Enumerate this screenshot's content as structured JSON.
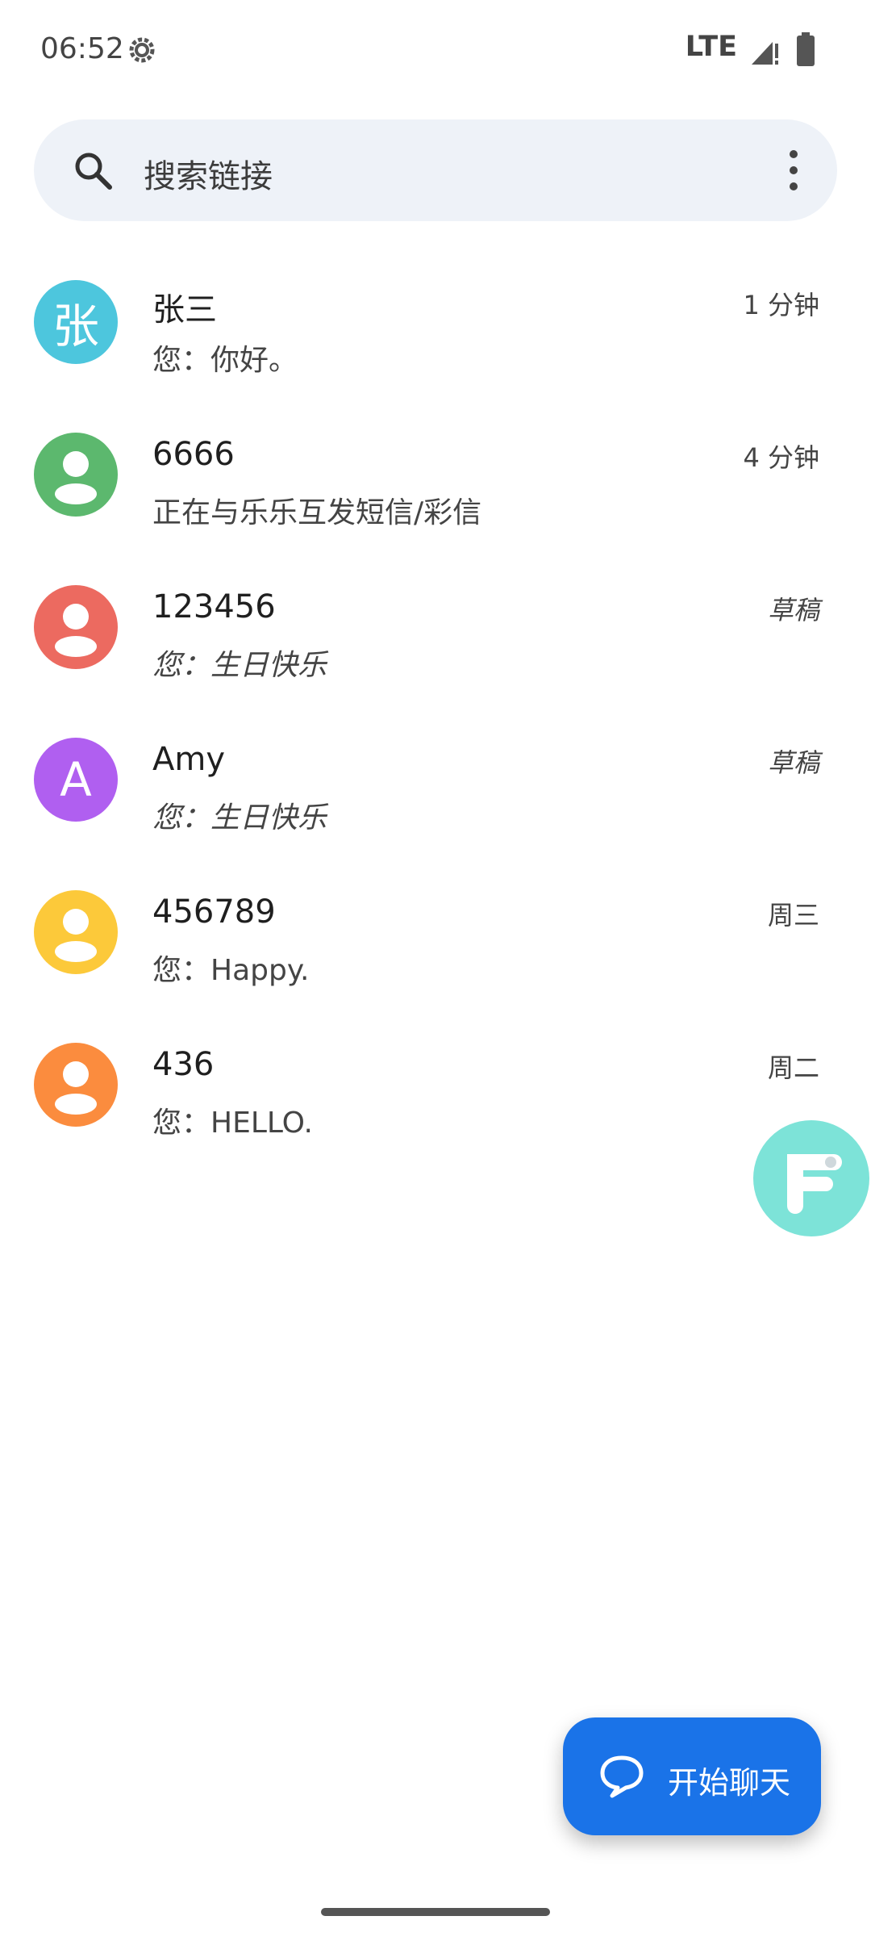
{
  "status": {
    "time": "06:52",
    "network": "LTE"
  },
  "search": {
    "placeholder": "搜索链接"
  },
  "conversations": [
    {
      "name": "张三",
      "snippet": "您：你好。",
      "time": "1 分钟",
      "avatar_letter": "张",
      "avatar_color": "#4dc6dd",
      "draft": false
    },
    {
      "name": "6666",
      "snippet": "正在与乐乐互发短信/彩信",
      "time": "4 分钟",
      "avatar_letter": "",
      "avatar_color": "#5cb86e",
      "draft": false
    },
    {
      "name": "123456",
      "snippet": "您：生日快乐",
      "time": "草稿",
      "avatar_letter": "",
      "avatar_color": "#ec6a60",
      "draft": true
    },
    {
      "name": "Amy",
      "snippet": "您：生日快乐",
      "time": "草稿",
      "avatar_letter": "A",
      "avatar_color": "#b05ff0",
      "draft": true
    },
    {
      "name": "456789",
      "snippet": "您：Happy.",
      "time": "周三",
      "avatar_letter": "",
      "avatar_color": "#fcc93a",
      "draft": false
    },
    {
      "name": "436",
      "snippet": "您：HELLO.",
      "time": "周二",
      "avatar_letter": "",
      "avatar_color": "#fb8c3e",
      "draft": false
    }
  ],
  "fab": {
    "label": "开始聊天"
  },
  "colors": {
    "accent": "#1a73e8",
    "search_bg": "#eef2f8",
    "floating_f": "#7de3d8"
  }
}
